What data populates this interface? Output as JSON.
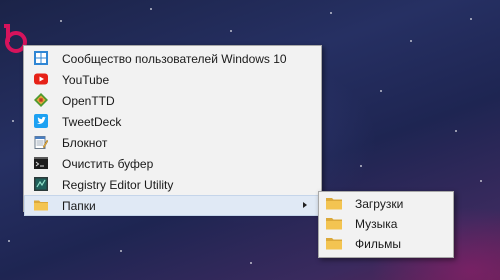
{
  "colors": {
    "wallpaper_primary": "#263063",
    "wallpaper_accent": "#5a2356",
    "menu_background": "#f2f2f2",
    "menu_border": "#a8a8a8",
    "highlight": "#e0e9f5",
    "folder_yellow": "#f3c451",
    "youtube_red": "#e62117",
    "tweetdeck_blue": "#1da1f2",
    "windows_blue": "#2f86d4",
    "logo_magenta": "#d6135c"
  },
  "menu": {
    "items": [
      {
        "label": "Сообщество пользователей Windows 10",
        "icon": "windows-community-icon"
      },
      {
        "label": "YouTube",
        "icon": "youtube-icon"
      },
      {
        "label": "OpenTTD",
        "icon": "openttd-icon"
      },
      {
        "label": "TweetDeck",
        "icon": "tweetdeck-icon"
      },
      {
        "label": "Блокнот",
        "icon": "notepad-icon"
      },
      {
        "label": "Очистить буфер",
        "icon": "clear-clipboard-icon"
      },
      {
        "label": "Registry Editor Utility",
        "icon": "registry-editor-icon"
      },
      {
        "label": "Папки",
        "icon": "folder-icon",
        "has_submenu": true,
        "active": true
      }
    ]
  },
  "submenu": {
    "items": [
      {
        "label": "Загрузки",
        "icon": "folder-icon"
      },
      {
        "label": "Музыка",
        "icon": "folder-icon"
      },
      {
        "label": "Фильмы",
        "icon": "folder-icon"
      }
    ]
  }
}
